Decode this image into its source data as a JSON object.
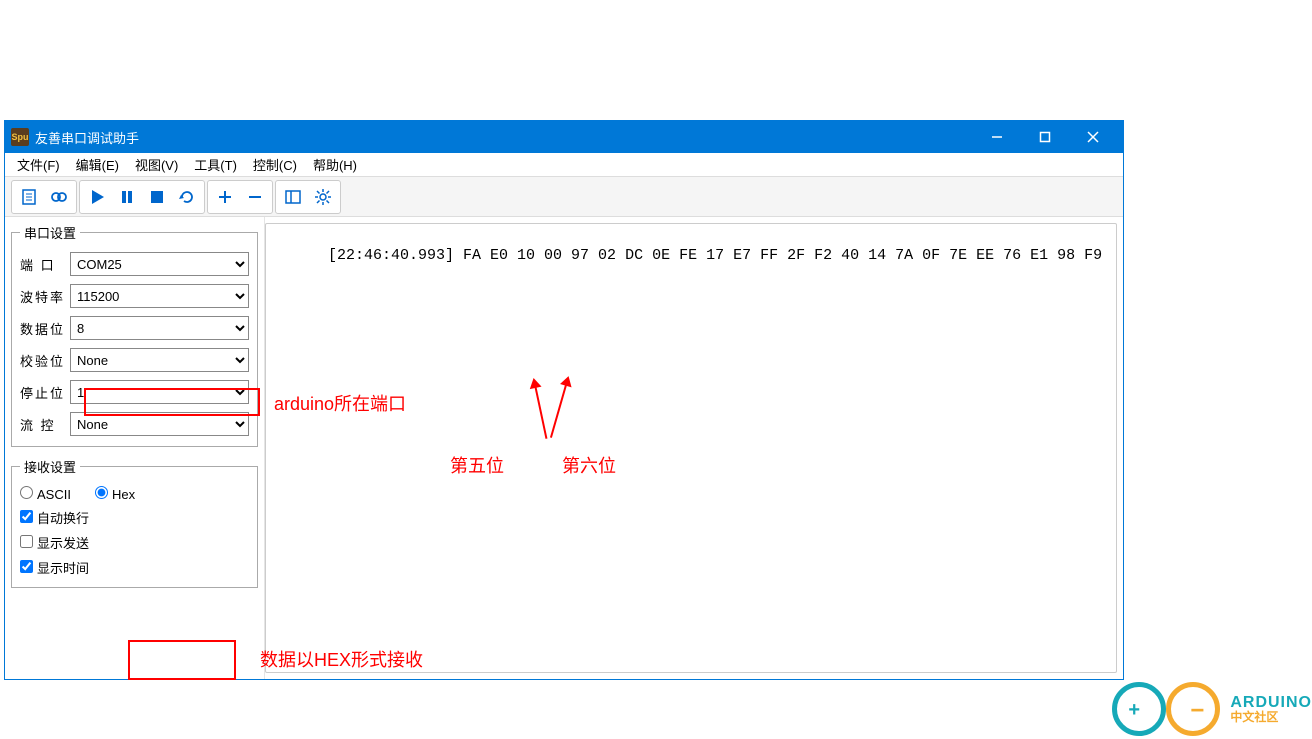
{
  "window": {
    "icon_text": "Spu",
    "title": "友善串口调试助手"
  },
  "menu": {
    "file": "文件(F)",
    "edit": "编辑(E)",
    "view": "视图(V)",
    "tool": "工具(T)",
    "ctrl": "控制(C)",
    "help": "帮助(H)"
  },
  "serial": {
    "legend": "串口设置",
    "labels": {
      "port": "端 口",
      "baud": "波特率",
      "data": "数据位",
      "parity": "校验位",
      "stop": "停止位",
      "flow": "流 控"
    },
    "port": "COM25",
    "baud": "115200",
    "data_bits": "8",
    "parity": "None",
    "stop_bits": "1",
    "flow": "None"
  },
  "rx": {
    "legend": "接收设置",
    "ascii": "ASCII",
    "hex": "Hex",
    "auto_wrap": "自动换行",
    "show_send": "显示发送",
    "show_time": "显示时间"
  },
  "output_line": "[22:46:40.993] FA E0 10 00 97 02 DC 0E FE 17 E7 FF 2F F2 40 14 7A 0F 7E EE 76 E1 98 F9",
  "annotations": {
    "arduino_port": "arduino所在端口",
    "fifth": "第五位",
    "sixth": "第六位",
    "hex_note": "数据以HEX形式接收"
  },
  "watermark": {
    "brand": "ARDUINO",
    "sub": "中文社区"
  }
}
